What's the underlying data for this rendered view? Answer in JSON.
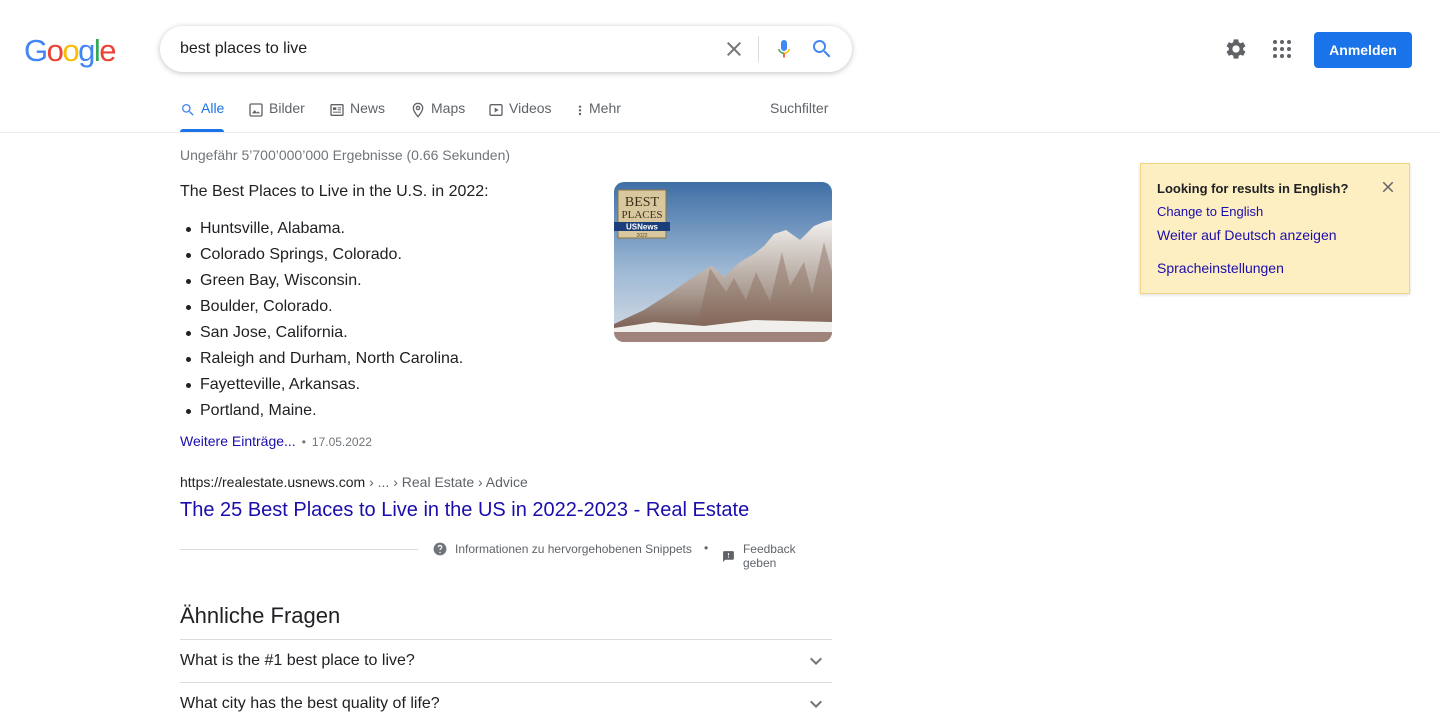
{
  "header": {
    "logo_letters": [
      {
        "char": "G",
        "color": "#4285F4"
      },
      {
        "char": "o",
        "color": "#EA4335"
      },
      {
        "char": "o",
        "color": "#FBBC05"
      },
      {
        "char": "g",
        "color": "#4285F4"
      },
      {
        "char": "l",
        "color": "#34A853"
      },
      {
        "char": "e",
        "color": "#EA4335"
      }
    ],
    "search_value": "best places to live",
    "icons": {
      "clear": "close-icon",
      "mic": "mic-icon",
      "search": "search-icon",
      "settings": "gear-icon",
      "apps": "apps-grid-icon"
    },
    "signin_label": "Anmelden"
  },
  "tabs": {
    "items": [
      {
        "label": "Alle",
        "icon": "search-icon",
        "active": true
      },
      {
        "label": "Bilder",
        "icon": "image-icon",
        "active": false
      },
      {
        "label": "News",
        "icon": "news-icon",
        "active": false
      },
      {
        "label": "Maps",
        "icon": "map-pin-icon",
        "active": false
      },
      {
        "label": "Videos",
        "icon": "video-icon",
        "active": false
      },
      {
        "label": "Mehr",
        "icon": "more-vert-icon",
        "active": false
      }
    ],
    "filter_label": "Suchfilter"
  },
  "results": {
    "stats": "Ungefähr 5’700’000’000 Ergebnisse (0.66 Sekunden)",
    "featured": {
      "heading": "The Best Places to Live in the U.S. in 2022:",
      "items": [
        "Huntsville, Alabama.",
        "Colorado Springs, Colorado.",
        "Green Bay, Wisconsin.",
        "Boulder, Colorado.",
        "San Jose, California.",
        "Raleigh and Durham, North Carolina.",
        "Fayetteville, Arkansas.",
        "Portland, Maine."
      ],
      "badge": {
        "line1": "BEST",
        "line2": "PLACES",
        "brand": "USNews",
        "tag": "2022"
      },
      "more_label": "Weitere Einträge...",
      "separator": "•",
      "date": "17.05.2022",
      "cite_domain": "https://realestate.usnews.com",
      "cite_path": " › ... › Real Estate › Advice",
      "title": "The 25 Best Places to Live in the US in 2022-2023 - Real Estate",
      "info_label": "Informationen zu hervorgehobenen Snippets",
      "footer_separator": "•",
      "feedback_label": "Feedback geben"
    },
    "paa": {
      "title": "Ähnliche Fragen",
      "questions": [
        "What is the #1 best place to live?",
        "What city has the best quality of life?"
      ]
    }
  },
  "language_notice": {
    "title": "Looking for results in English?",
    "links": [
      "Change to English",
      "Weiter auf Deutsch anzeigen",
      "Spracheinstellungen"
    ]
  },
  "colors": {
    "accent": "#1a73e8",
    "link": "#1a0dab",
    "notice_bg": "#feefc3"
  }
}
